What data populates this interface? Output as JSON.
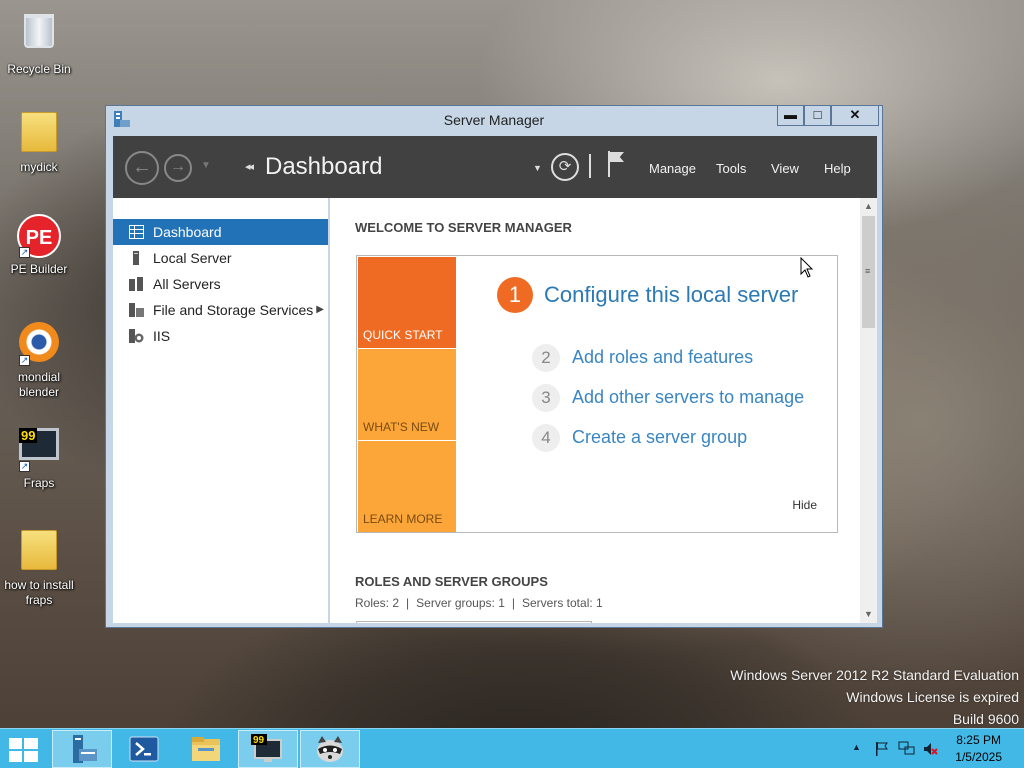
{
  "desktop": {
    "icons": [
      {
        "label": "Recycle Bin"
      },
      {
        "label": "mydick"
      },
      {
        "label": "PE Builder"
      },
      {
        "label": "mondial blender"
      },
      {
        "label": "Fraps"
      },
      {
        "label": "how to install fraps"
      }
    ],
    "pe_text": "PE",
    "fraps_text": "99"
  },
  "window": {
    "title": "Server Manager",
    "caption": {
      "minimize": "▬",
      "maximize": "□",
      "close": "✕"
    }
  },
  "toolbar": {
    "breadcrumb": "Dashboard",
    "breadcrumb_arrows": "◂◂",
    "menus": [
      "Manage",
      "Tools",
      "View",
      "Help"
    ]
  },
  "nav": {
    "items": [
      {
        "label": "Dashboard",
        "icon": "dashboard-icon",
        "active": true
      },
      {
        "label": "Local Server",
        "icon": "server-icon"
      },
      {
        "label": "All Servers",
        "icon": "servers-icon"
      },
      {
        "label": "File and Storage Services",
        "icon": "storage-icon",
        "has_submenu": true
      },
      {
        "label": "IIS",
        "icon": "iis-icon"
      }
    ],
    "submenu_glyph": "▶"
  },
  "welcome": {
    "heading": "WELCOME TO SERVER MANAGER",
    "tiles": [
      "QUICK START",
      "WHAT'S NEW",
      "LEARN MORE"
    ],
    "steps": [
      {
        "num": "1",
        "label": "Configure this local server"
      },
      {
        "num": "2",
        "label": "Add roles and features"
      },
      {
        "num": "3",
        "label": "Add other servers to manage"
      },
      {
        "num": "4",
        "label": "Create a server group"
      }
    ],
    "hide": "Hide"
  },
  "roles": {
    "heading": "ROLES AND SERVER GROUPS",
    "roles": "Roles: 2",
    "server_groups": "Server groups: 1",
    "servers_total": "Servers total: 1",
    "separator": "|"
  },
  "watermark": {
    "line1": "Windows Server 2012 R2 Standard Evaluation",
    "line2": "Windows License is expired",
    "line3": "Build 9600"
  },
  "taskbar": {
    "clock_time": "8:25 PM",
    "clock_date": "1/5/2025",
    "tray_arrow": "▲"
  },
  "colors": {
    "accent": "#2272b8",
    "quick_start": "#ef6a22",
    "tiles": "#fca63a",
    "toolbar": "#414141",
    "taskbar": "#41b8e6"
  }
}
